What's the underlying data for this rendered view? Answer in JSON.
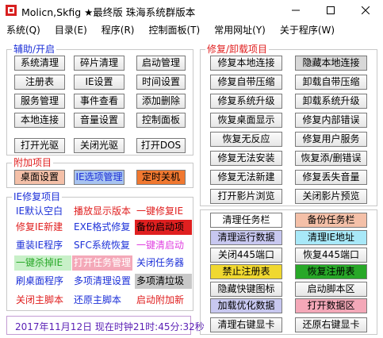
{
  "window": {
    "title": "Molicn,Skfig ★最终版 珠海系统群版本",
    "icon": "app-logo-icon",
    "controls": [
      "minimize-icon",
      "maximize-icon",
      "close-icon"
    ]
  },
  "menu": [
    "系统(Q)",
    "目录(E)",
    "程序(R)",
    "控制面板(T)",
    "常用网址(Y)",
    "关于程序(W)"
  ],
  "aux": {
    "title": "辅助/开启",
    "rows": [
      [
        "系统清理",
        "碎片清理",
        "启动管理"
      ],
      [
        "注册表",
        "IE设置",
        "时间设置"
      ],
      [
        "服务管理",
        "事件查看",
        "添加删除"
      ],
      [
        "本地连接",
        "音量设置",
        "控制面板"
      ],
      [
        "打开光驱",
        "关闭光驱",
        "打开DOS"
      ]
    ]
  },
  "extra": {
    "title": "附加项目",
    "buttons": [
      "桌面设置",
      "IE选项管理",
      "定时关机"
    ]
  },
  "ie": {
    "title": "IE修复项目",
    "rows": [
      [
        "IE默认空白",
        "播放显示版本",
        "一键修复IE"
      ],
      [
        "修复IE新建",
        "EXE格式修复",
        "备份启动项"
      ],
      [
        "重装IE程序",
        "SFC系统恢复",
        "一键清启动"
      ],
      [
        "一键杀掉IE",
        "打开任务管理",
        "关闭任务器"
      ],
      [
        "刷桌面程序",
        "多项清理设置",
        "多项清垃圾"
      ],
      [
        "关闭主脚本",
        "还原主脚本",
        "启动附加新"
      ]
    ]
  },
  "status": "2017年11月12日 现在时钟21时:45分:32秒",
  "repair": {
    "title": "修复/卸载项目",
    "rows": [
      [
        "修复本地连接",
        "隐藏本地连接"
      ],
      [
        "修复自带压缩",
        "卸载自带压缩"
      ],
      [
        "修复系统升级",
        "卸载系统升级"
      ],
      [
        "恢复桌面显示",
        "修复内部错误"
      ],
      [
        "恢复无反应",
        "修复用户服务"
      ],
      [
        "修复无法安装",
        "恢复添/删错误"
      ],
      [
        "修复无法新建",
        "修复丢失音量"
      ],
      [
        "打开影片浏览",
        "关闭影片预览"
      ]
    ]
  },
  "tools": {
    "rows": [
      [
        "清理任务栏",
        "备份任务栏"
      ],
      [
        "清理运行数据",
        "清理IE地址"
      ],
      [
        "关闭445端口",
        "恢复445端口"
      ],
      [
        "禁止注册表",
        "恢复注册表"
      ],
      [
        "隐藏快键图标",
        "启动脚本区"
      ],
      [
        "加载优化数据",
        "打开数据区"
      ],
      [
        "清理右键显卡",
        "还原右键显卡"
      ]
    ]
  },
  "colors": {
    "blue_text": "#1c30d8",
    "red_text": "#e02020",
    "purple_text": "#5a1fb5",
    "btn_salmon": "#f4c0a8",
    "btn_blue": "#a8c4f0",
    "btn_orange": "#f07830",
    "btn_cyan": "#a8e8f8",
    "btn_yellow": "#f0d830",
    "btn_green": "#28a828",
    "btn_pink": "#f4a8b8",
    "btn_mint": "#c8f0c8",
    "btn_lavender": "#c8c8f0",
    "btn_gray": "#d8d8d8"
  }
}
